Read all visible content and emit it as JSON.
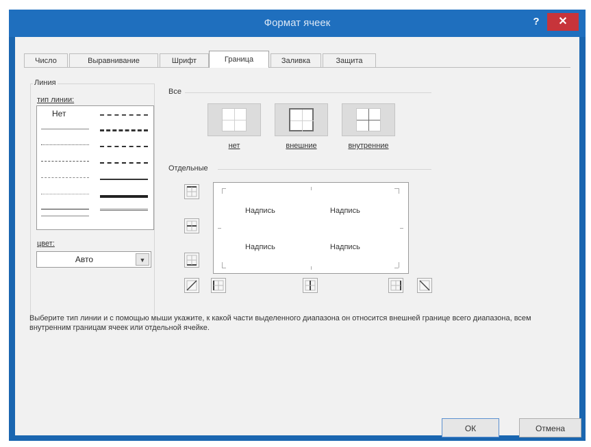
{
  "dialog": {
    "title": "Формат ячеек",
    "help": "?",
    "close": "✕"
  },
  "tabs": [
    {
      "label": "Число"
    },
    {
      "label": "Выравнивание"
    },
    {
      "label": "Шрифт"
    },
    {
      "label": "Граница"
    },
    {
      "label": "Заливка"
    },
    {
      "label": "Защита"
    }
  ],
  "active_tab": "Граница",
  "line": {
    "group_label": "Линия",
    "type_label": "тип линии:",
    "none_label": "Нет",
    "color_label": "цвет:",
    "color_value": "Авто"
  },
  "presets": {
    "group_label": "Все",
    "items": [
      {
        "label": "нет"
      },
      {
        "label": "внешние"
      },
      {
        "label": "внутренние"
      }
    ]
  },
  "border": {
    "group_label": "Отдельные",
    "preview_texts": [
      "Надпись",
      "Надпись",
      "Надпись",
      "Надпись"
    ]
  },
  "description": "Выберите тип линии и с помощью мыши укажите, к какой части выделенного диапазона он относится внешней границе всего диапазона, всем внутренним границам ячеек или отдельной ячейке.",
  "buttons": {
    "ok": "ОК",
    "cancel": "Отмена"
  },
  "colors": {
    "titlebar": "#1f6fbe",
    "close": "#c7343a",
    "dialog_bg": "#f1f1f1"
  }
}
